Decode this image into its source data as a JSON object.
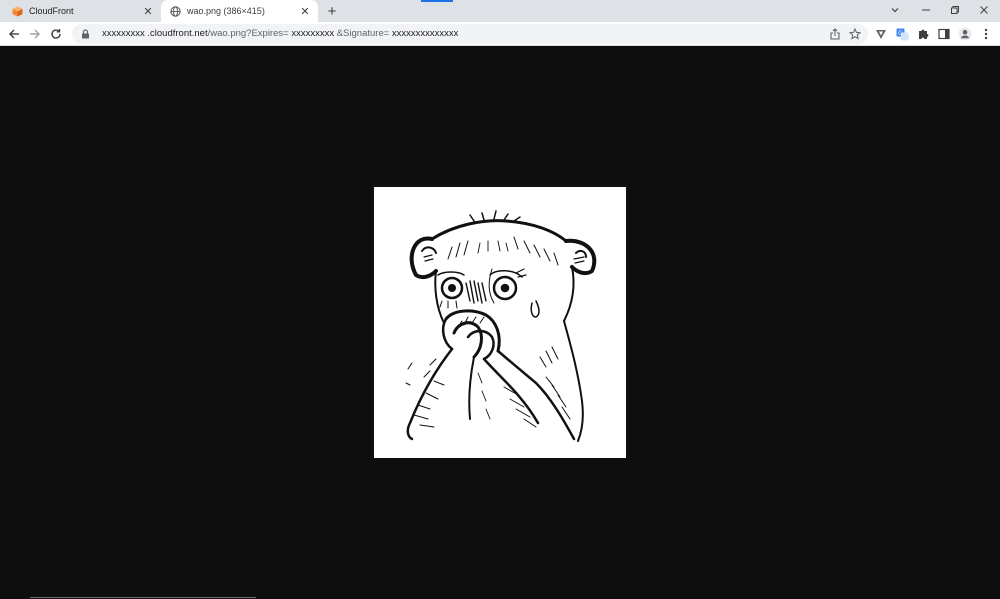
{
  "tabs": [
    {
      "title": "CloudFront",
      "favicon": "cloudfront-cube-icon",
      "active": false
    },
    {
      "title": "wao.png (386×415)",
      "favicon": "globe-icon",
      "active": true
    }
  ],
  "new_tab_label": "+",
  "address_bar": {
    "url_host": "xxxxxxxxx .cloudfront.net",
    "url_path": "/wao.png?Expires=",
    "url_expires": " xxxxxxxxx ",
    "url_sig_label": " &Signature=",
    "url_sig": " xxxxxxxxxxxxxx"
  },
  "icons": {
    "back": "back-arrow-icon",
    "forward": "forward-arrow-icon",
    "reload": "reload-icon",
    "lock": "lock-icon",
    "share": "share-icon",
    "bookmark": "star-icon",
    "extension_v": "v-extension-icon",
    "translate": "translate-icon",
    "extensions": "puzzle-icon",
    "sidepanel": "side-panel-icon",
    "profile": "profile-icon",
    "menu": "kebab-menu-icon"
  },
  "colors": {
    "page_background": "#0e0e0e",
    "tab_strip": "#dee1e6",
    "accent": "#1a73e8",
    "cloudfront_orange": "#f58536"
  },
  "image": {
    "name": "wao.png",
    "width": 386,
    "height": 415,
    "subject": "sketch-of-shocked-furry-creature"
  }
}
